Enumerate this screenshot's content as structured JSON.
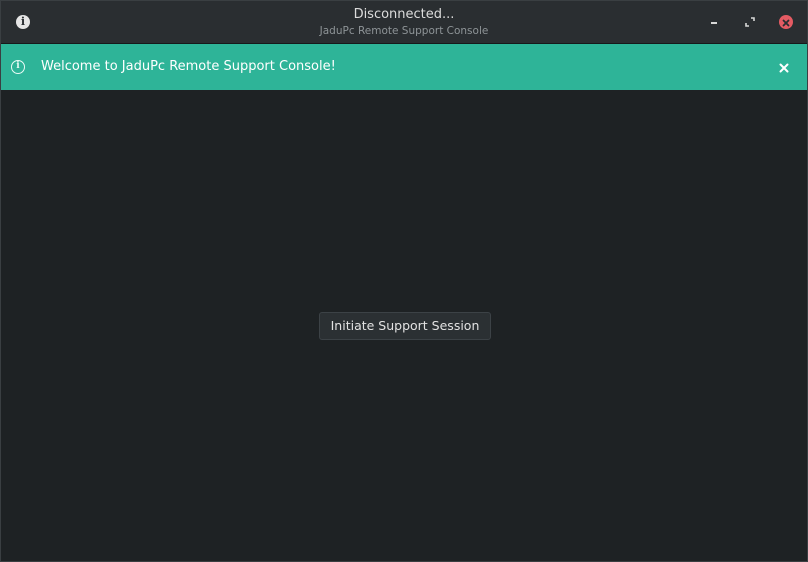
{
  "window": {
    "title": "Disconnected...",
    "subtitle": "JaduPc Remote Support Console",
    "title_icon": "info-icon",
    "controls": {
      "minimize_icon": "minimize-icon",
      "maximize_icon": "maximize-icon",
      "close_icon": "close-icon",
      "close_color": "#e45b63"
    }
  },
  "banner": {
    "icon": "info-icon",
    "message": "Welcome to JaduPc Remote Support Console!",
    "close_icon": "close-icon",
    "color": "#2eb498"
  },
  "main": {
    "session_button_label": "Initiate Support Session"
  }
}
